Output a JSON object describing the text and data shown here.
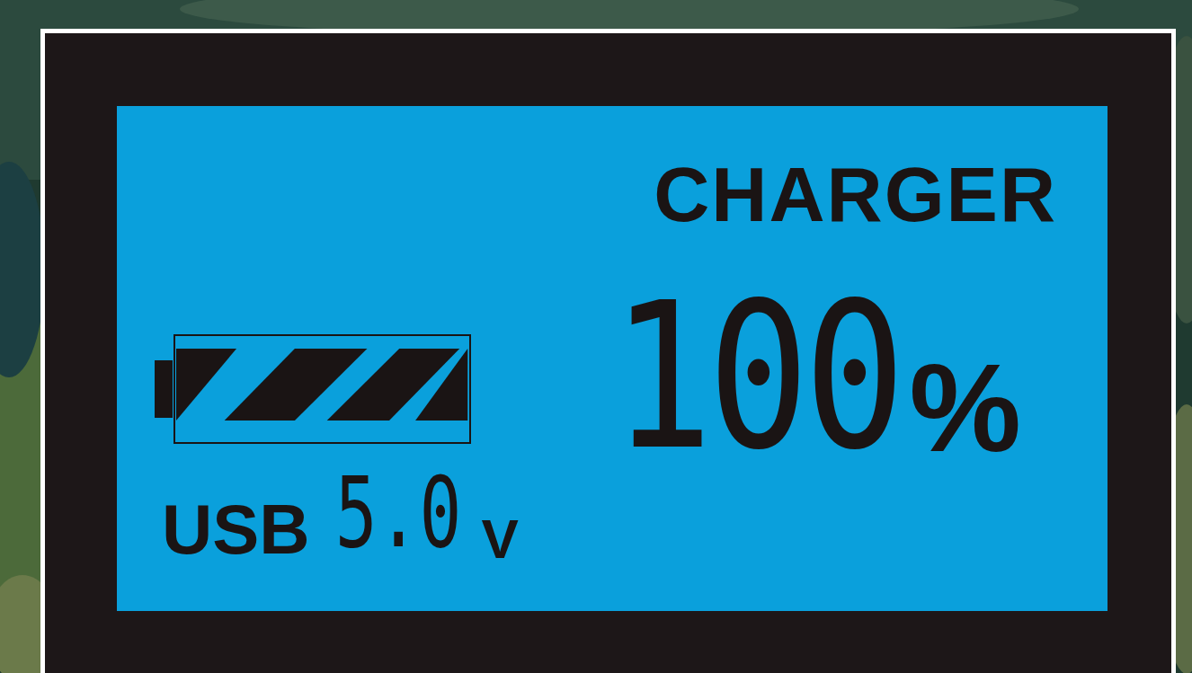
{
  "display": {
    "title": "CHARGER",
    "percent": "100",
    "percent_unit": "%",
    "battery": {
      "level": 1
    },
    "input_label": "USB",
    "voltage": "5.0",
    "voltage_unit": "V"
  }
}
